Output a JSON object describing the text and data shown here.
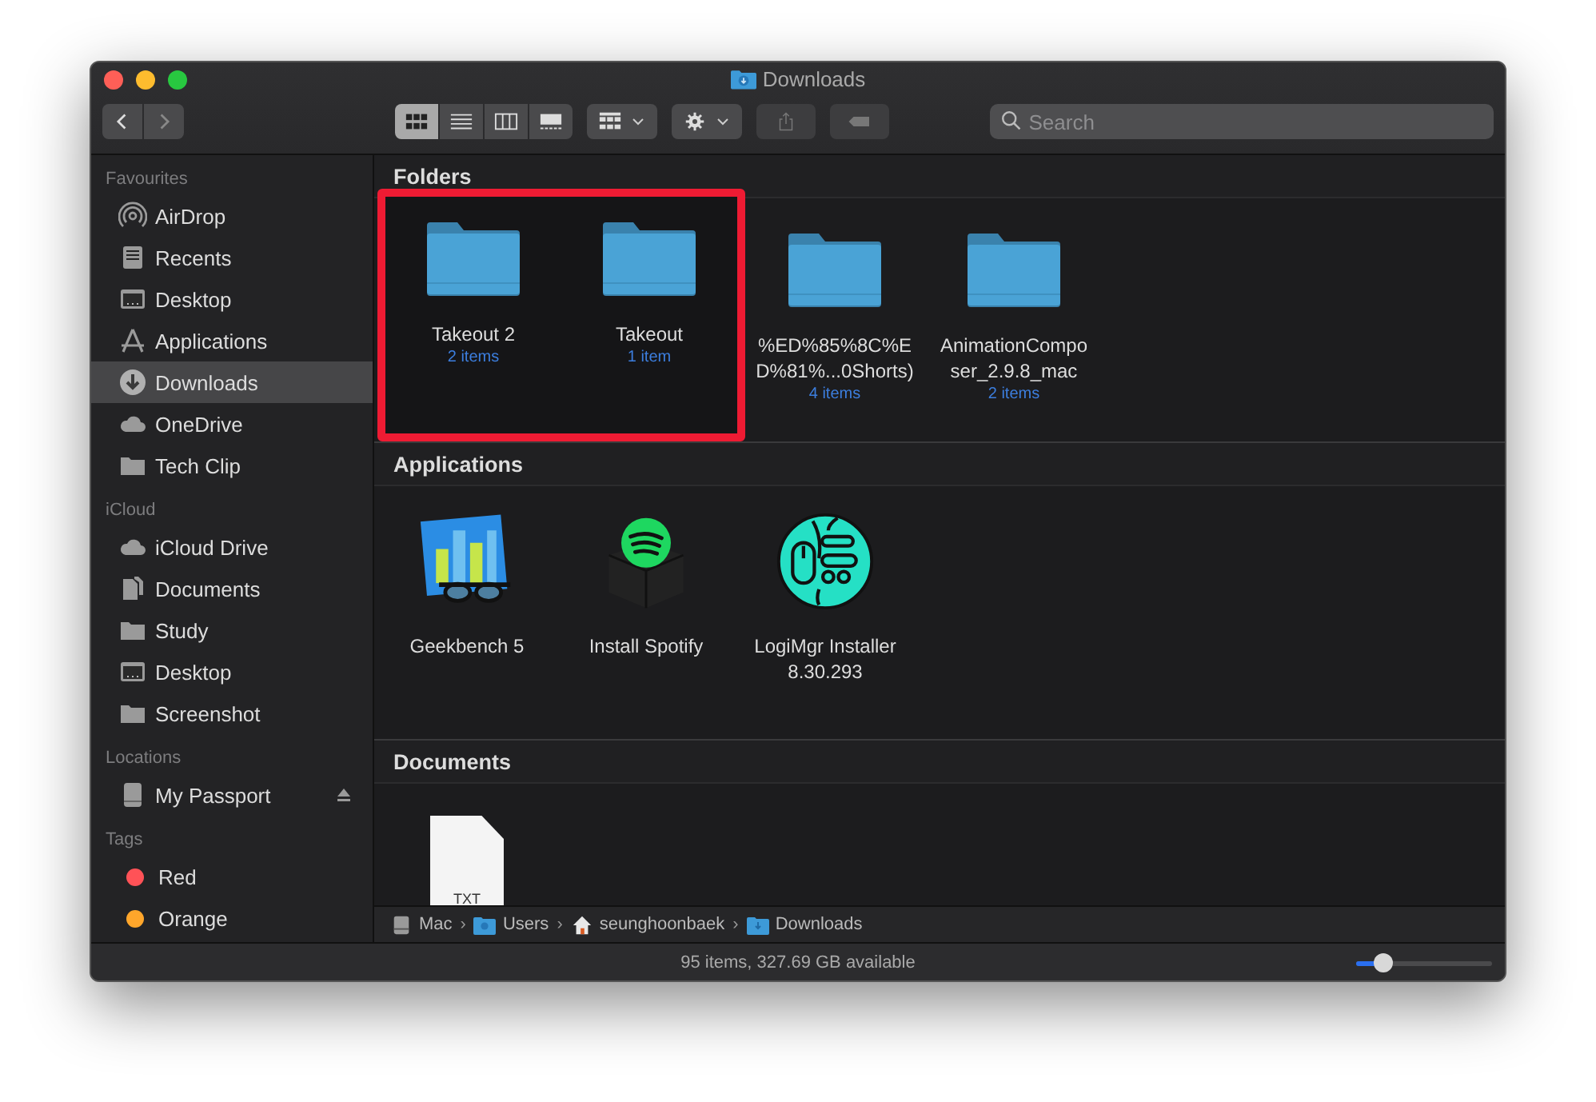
{
  "window": {
    "title": "Downloads"
  },
  "toolbar": {
    "view_modes": [
      {
        "kind": "icons",
        "selected": true
      },
      {
        "kind": "list",
        "selected": false
      },
      {
        "kind": "columns",
        "selected": false
      },
      {
        "kind": "gallery",
        "selected": false
      }
    ],
    "search": {
      "placeholder": "Search"
    }
  },
  "sidebar": {
    "sections": [
      {
        "title": "Favourites",
        "items": [
          {
            "kind": "airdrop",
            "label": "AirDrop",
            "selected": false
          },
          {
            "kind": "recents",
            "label": "Recents",
            "selected": false
          },
          {
            "kind": "desktop",
            "label": "Desktop",
            "selected": false
          },
          {
            "kind": "apps",
            "label": "Applications",
            "selected": false
          },
          {
            "kind": "download",
            "label": "Downloads",
            "selected": true
          },
          {
            "kind": "cloud",
            "label": "OneDrive",
            "selected": false
          },
          {
            "kind": "folder",
            "label": "Tech Clip",
            "selected": false
          }
        ]
      },
      {
        "title": "iCloud",
        "items": [
          {
            "kind": "cloud",
            "label": "iCloud Drive",
            "selected": false
          },
          {
            "kind": "docs",
            "label": "Documents",
            "selected": false
          },
          {
            "kind": "folder",
            "label": "Study",
            "selected": false
          },
          {
            "kind": "desktop",
            "label": "Desktop",
            "selected": false
          },
          {
            "kind": "folder",
            "label": "Screenshot",
            "selected": false
          }
        ]
      },
      {
        "title": "Locations",
        "items": [
          {
            "kind": "drive",
            "label": "My Passport",
            "selected": false,
            "eject": true
          }
        ]
      },
      {
        "title": "Tags",
        "items": [
          {
            "kind": "tag",
            "label": "Red",
            "color": "#ff5257",
            "selected": false
          },
          {
            "kind": "tag",
            "label": "Orange",
            "color": "#ffa62b",
            "selected": false
          }
        ]
      }
    ]
  },
  "folders": {
    "title": "Folders",
    "highlighted": [
      {
        "lines": [
          "Takeout 2"
        ],
        "count": "2 items"
      },
      {
        "lines": [
          "Takeout"
        ],
        "count": "1 item"
      }
    ],
    "others": [
      {
        "lines": [
          "%ED%85%8C%E",
          "D%81%...0Shorts)"
        ],
        "count": "4 items"
      },
      {
        "lines": [
          "AnimationCompo",
          "ser_2.9.8_mac"
        ],
        "count": "2 items"
      }
    ]
  },
  "applications": {
    "title": "Applications",
    "items": [
      {
        "kind": "geekbench",
        "lines": [
          "Geekbench 5"
        ]
      },
      {
        "kind": "spotify",
        "lines": [
          "Install Spotify"
        ]
      },
      {
        "kind": "logi",
        "lines": [
          "LogiMgr Installer",
          "8.30.293"
        ]
      }
    ]
  },
  "documents": {
    "title": "Documents",
    "items": [
      {
        "badge": "TXT"
      }
    ]
  },
  "path_bar": [
    {
      "kind": "drive",
      "label": "Mac"
    },
    {
      "kind": "bluefolder",
      "separator": "›",
      "label": "Users"
    },
    {
      "kind": "home",
      "separator": "›",
      "label": "seunghoonbaek"
    },
    {
      "kind": "download",
      "separator": "›",
      "label": "Downloads"
    }
  ],
  "status_bar": {
    "text": "95 items, 327.69 GB available",
    "icon_size": {
      "level": 0.2
    }
  }
}
